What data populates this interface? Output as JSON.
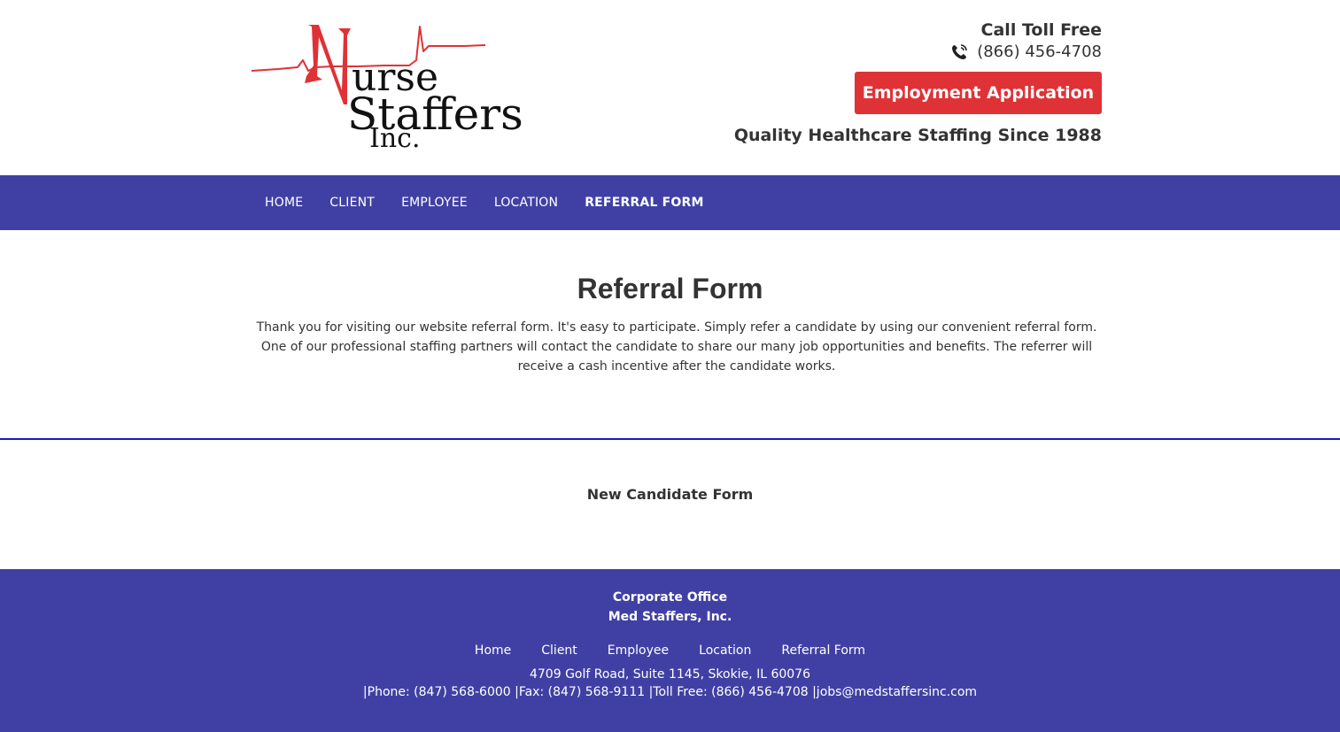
{
  "logo": {
    "letter_n": "N",
    "line_urse": "urse",
    "line_staffers": "Staffers",
    "line_inc": "Inc.",
    "accent_color": "#df3236"
  },
  "header": {
    "call_label": "Call Toll Free",
    "phone": "(866) 456-4708",
    "phone_icon": "phone-icon",
    "employment_button": "Employment Application",
    "tagline": "Quality Healthcare Staffing Since 1988"
  },
  "nav": {
    "items": [
      {
        "label": "HOME"
      },
      {
        "label": "CLIENT"
      },
      {
        "label": "EMPLOYEE"
      },
      {
        "label": "LOCATION"
      },
      {
        "label": "REFERRAL FORM",
        "active": true
      }
    ],
    "background": "#4040a4"
  },
  "main": {
    "title": "Referral Form",
    "intro": "Thank you for visiting our website referral form. It's easy to participate. Simply refer a candidate by using our convenient referral form. One of our professional staffing partners will contact the candidate to share our many job opportunities and benefits. The referrer will receive a cash incentive after the candidate works."
  },
  "form_section": {
    "title": "New Candidate Form"
  },
  "footer": {
    "office_label": "Corporate Office",
    "company": "Med Staffers, Inc.",
    "links": [
      "Home",
      "Client",
      "Employee",
      "Location",
      "Referral Form"
    ],
    "address": "4709 Golf Road, Suite 1145, Skokie, IL 60076",
    "contact_line": "|Phone: (847) 568-6000 |Fax: (847) 568-9111 |Toll Free: (866) 456-4708 |jobs@medstaffersinc.com"
  }
}
